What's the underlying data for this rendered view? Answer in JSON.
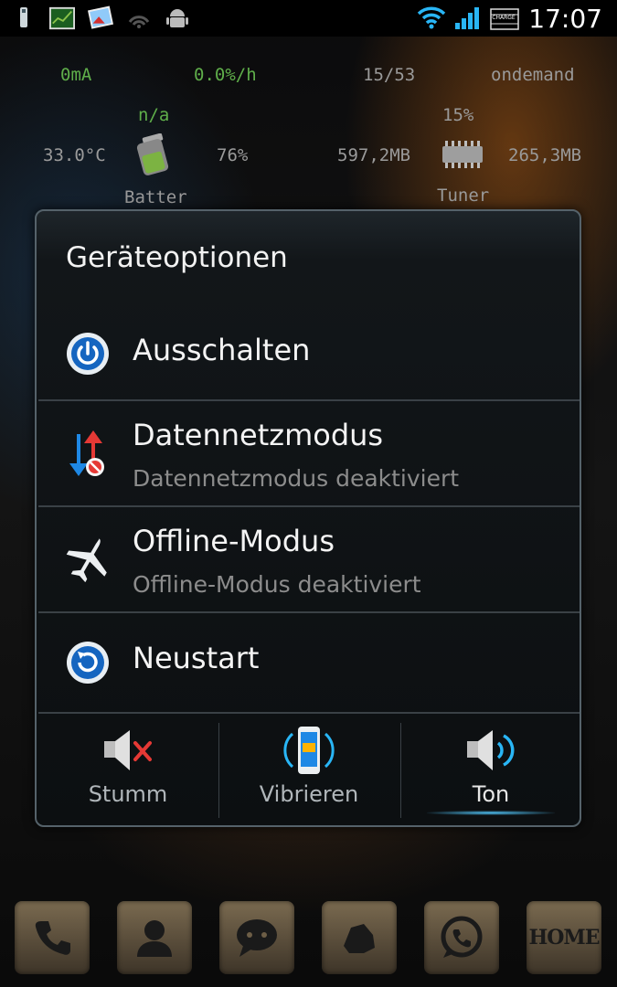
{
  "status_bar": {
    "time": "17:07",
    "battery_label": "CHARGE",
    "icons": [
      "usb-icon",
      "chart-icon",
      "image-icon",
      "signal-off-icon",
      "android-debug-icon",
      "wifi-icon",
      "signal-bars-icon",
      "battery-icon"
    ]
  },
  "widget": {
    "current": "0mA",
    "rate": "0.0%/h",
    "battery_status": "n/a",
    "temperature": "33.0°C",
    "battery_percent": "76%",
    "battery_label": "Batter",
    "cpu_count": "15/53",
    "governor": "ondemand",
    "cpu_percent": "15%",
    "mem_used": "597,2MB",
    "mem_free": "265,3MB",
    "tuner_label": "Tuner"
  },
  "dialog": {
    "title": "Geräteoptionen",
    "items": [
      {
        "label": "Ausschalten",
        "subtitle": "",
        "icon": "power-icon"
      },
      {
        "label": "Datennetzmodus",
        "subtitle": "Datennetzmodus deaktiviert",
        "icon": "data-network-icon"
      },
      {
        "label": "Offline-Modus",
        "subtitle": "Offline-Modus deaktiviert",
        "icon": "airplane-icon"
      },
      {
        "label": "Neustart",
        "subtitle": "",
        "icon": "restart-icon"
      }
    ],
    "sound_modes": [
      {
        "label": "Stumm",
        "icon": "mute-speaker-icon",
        "selected": false
      },
      {
        "label": "Vibrieren",
        "icon": "vibrate-phone-icon",
        "selected": false
      },
      {
        "label": "Ton",
        "icon": "sound-speaker-icon",
        "selected": true
      }
    ],
    "accent_color": "#4fc3f7"
  },
  "dock": {
    "icons": [
      "phone-icon",
      "contacts-icon",
      "messaging-icon",
      "app-icon",
      "whatsapp-icon",
      "home-icon"
    ],
    "home_label": "HOME"
  }
}
